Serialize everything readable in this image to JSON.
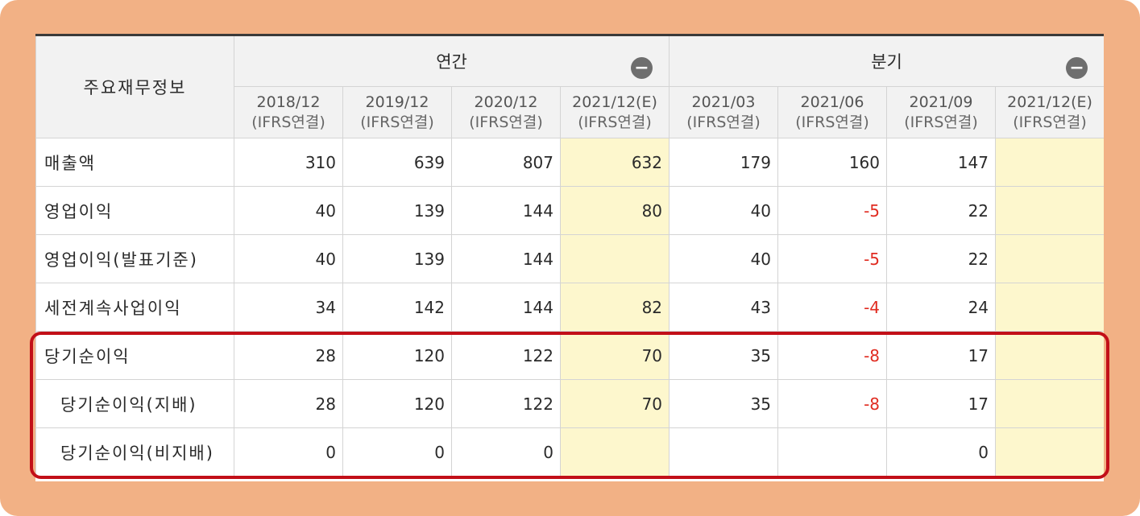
{
  "table": {
    "header_main": "주요재무정보",
    "group_annual": "연간",
    "group_quarter": "분기",
    "periods": [
      {
        "date": "2018/12",
        "basis": "(IFRS연결)"
      },
      {
        "date": "2019/12",
        "basis": "(IFRS연결)"
      },
      {
        "date": "2020/12",
        "basis": "(IFRS연결)"
      },
      {
        "date": "2021/12(E)",
        "basis": "(IFRS연결)"
      },
      {
        "date": "2021/03",
        "basis": "(IFRS연결)"
      },
      {
        "date": "2021/06",
        "basis": "(IFRS연결)"
      },
      {
        "date": "2021/09",
        "basis": "(IFRS연결)"
      },
      {
        "date": "2021/12(E)",
        "basis": "(IFRS연결)"
      }
    ],
    "rows": [
      {
        "label": "매출액",
        "values": [
          "310",
          "639",
          "807",
          "632",
          "179",
          "160",
          "147",
          ""
        ]
      },
      {
        "label": "영업이익",
        "values": [
          "40",
          "139",
          "144",
          "80",
          "40",
          "-5",
          "22",
          ""
        ]
      },
      {
        "label": "영업이익(발표기준)",
        "values": [
          "40",
          "139",
          "144",
          "",
          "40",
          "-5",
          "22",
          ""
        ]
      },
      {
        "label": "세전계속사업이익",
        "values": [
          "34",
          "142",
          "144",
          "82",
          "43",
          "-4",
          "24",
          ""
        ]
      },
      {
        "label": "당기순이익",
        "values": [
          "28",
          "120",
          "122",
          "70",
          "35",
          "-8",
          "17",
          ""
        ]
      },
      {
        "label": "당기순이익(지배)",
        "values": [
          "28",
          "120",
          "122",
          "70",
          "35",
          "-8",
          "17",
          ""
        ]
      },
      {
        "label": "당기순이익(비지배)",
        "values": [
          "0",
          "0",
          "0",
          "",
          "",
          "",
          "0",
          ""
        ]
      }
    ]
  },
  "colors": {
    "frame": "#f2b185",
    "estimate_bg": "#fdf7cd",
    "negative": "#e02b20",
    "highlight_border": "#c20f18"
  },
  "icons": {
    "collapse_annual": "minus-circle-icon",
    "collapse_quarter": "minus-circle-icon"
  }
}
